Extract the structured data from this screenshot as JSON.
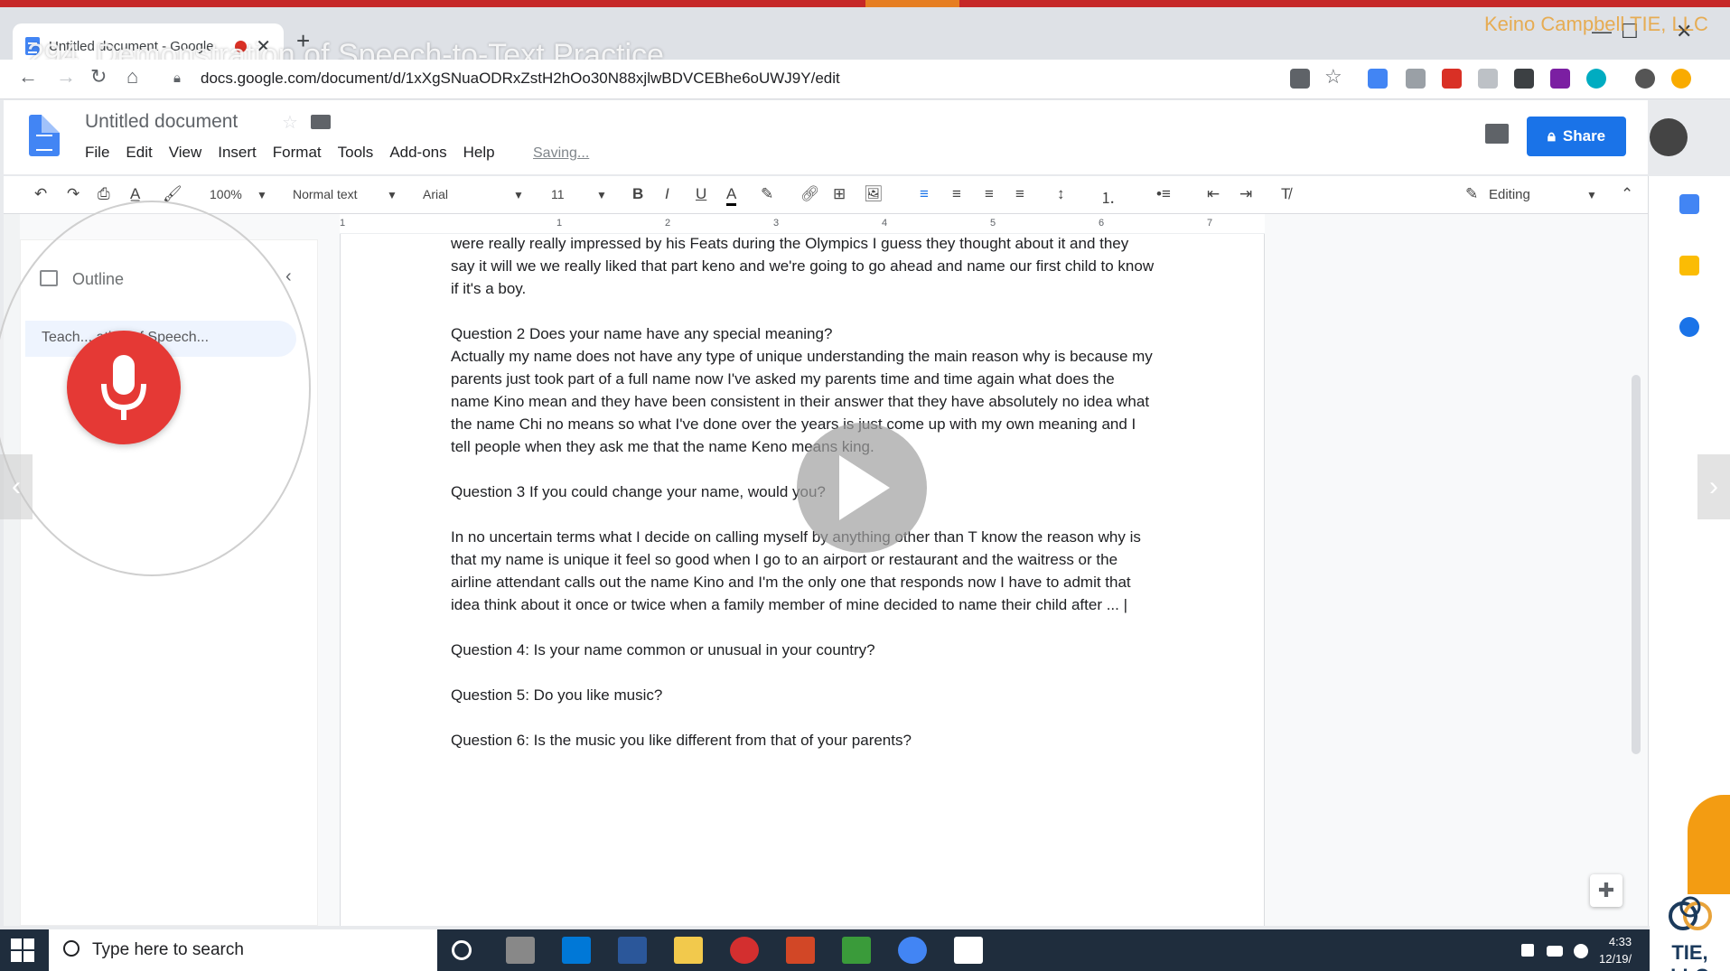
{
  "video": {
    "overlay_title": "294. Demonstration of Speech-to-Text Practice",
    "watermark": "Keino Campbell TIE, LLC"
  },
  "browser": {
    "tab_title": "Untitled document - Google",
    "url": "docs.google.com/document/d/1xXgSNuaODRxZstH2hOo30N88xjlwBDVCEBhe6oUWJ9Y/edit"
  },
  "docs": {
    "title": "Untitled document",
    "menu": [
      "File",
      "Edit",
      "View",
      "Insert",
      "Format",
      "Tools",
      "Add-ons",
      "Help"
    ],
    "saving_status": "Saving...",
    "share_label": "Share",
    "toolbar": {
      "zoom": "100%",
      "style": "Normal text",
      "font": "Arial",
      "font_size": "11",
      "mode": "Editing"
    },
    "outline": {
      "label": "Outline",
      "item": "Teach... ation of Speech..."
    },
    "ruler_numbers": [
      "1",
      "1",
      "2",
      "3",
      "4",
      "5",
      "6",
      "7"
    ],
    "paragraphs": [
      "were really really impressed by his Feats during the Olympics I guess they thought about it and they say it will we we really liked that part keno and we're going to go ahead and name our first child to know if it's a boy.",
      "Question 2 Does your name have any special meaning?",
      "Actually my name does not have any type of unique understanding the main reason why is because my parents just took part of a full name now I've asked my parents time and time again what does the name Kino mean and they have been consistent in their answer that they have absolutely no idea what the name Chi no means so what I've done over the years is just come up with my own meaning and I tell people when they ask me that the name Keno means king.",
      "Question 3 If you could change your name, would you?",
      "In no uncertain terms what I decide on calling myself by anything other than T know the reason why is that my name is unique it feel so good when I go to an airport or restaurant and the waitress or the airline attendant calls out the name Kino and I'm the only one that responds now I have to admit that idea think about it once or twice when a family member of mine decided to name their child after ... |",
      "Question 4: Is your name common or unusual in your country?",
      "Question 5: Do you like music?",
      "Question 6: Is the music you like different from that of your parents?"
    ]
  },
  "taskbar": {
    "search_placeholder": "Type here to search",
    "time": "4:33",
    "date": "12/19/"
  },
  "logo": {
    "text": "TIE, LLC"
  },
  "colors": {
    "accent": "#1a73e8",
    "mic": "#e53935",
    "video_bar": "#c62828"
  }
}
